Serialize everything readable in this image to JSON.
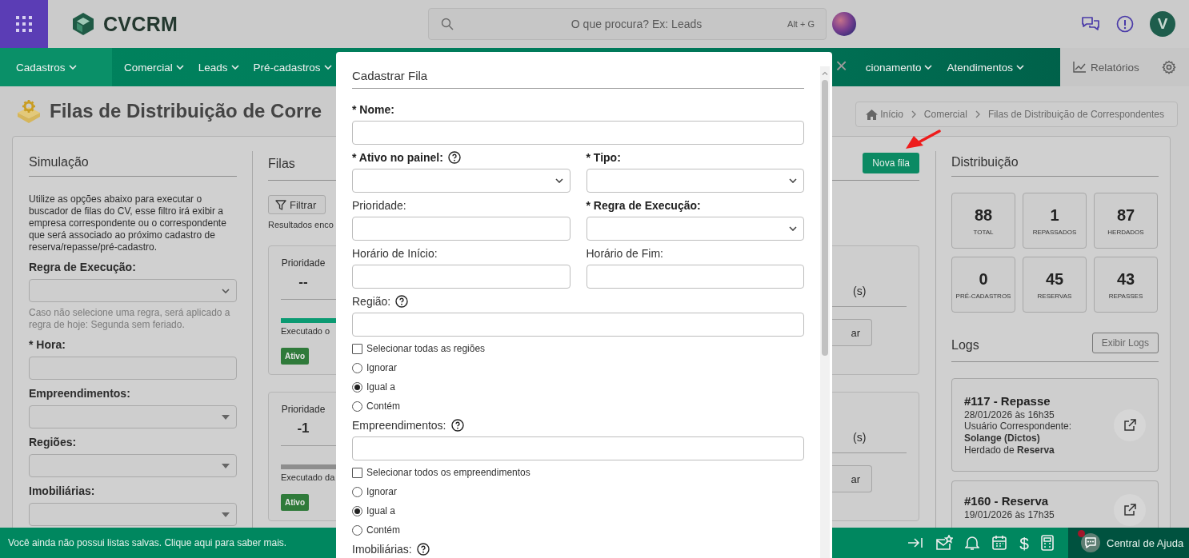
{
  "header": {
    "logo": "**CV**CRM",
    "search": {
      "placeholder": "O que procura? Ex: Leads",
      "shortcut": "Alt + G"
    },
    "avatar": "V"
  },
  "nav": {
    "left_items": [
      {
        "label": "Cadastros",
        "selected": true
      },
      {
        "label": "Comercial",
        "selected": false
      },
      {
        "label": "Leads",
        "selected": false
      },
      {
        "label": "Pré-cadastros",
        "selected": false
      }
    ],
    "right_items": [
      {
        "label": "cionamento",
        "selected": false
      },
      {
        "label": "Atendimentos",
        "selected": false
      }
    ],
    "reports": "Relatórios"
  },
  "page": {
    "title": "Filas de Distribuição de Corre",
    "breadcrumb": [
      "Início",
      "Comercial",
      "Filas de Distribuição de Correspondentes"
    ]
  },
  "simulation": {
    "title": "Simulação",
    "description": "Utilize as opções abaixo para executar o buscador de filas do CV, esse filtro irá exibir a empresa correspondente ou o correspondente que será associado ao próximo cadastro de reserva/repasse/pré-cadastro.",
    "fields": [
      {
        "label": "Regra de Execução:",
        "kind": "select",
        "hint": "Caso não selecione uma regra, será aplicado a regra de hoje: Segunda sem feriado."
      },
      {
        "label": "* Hora:",
        "kind": "input"
      },
      {
        "label": "Empreendimentos:",
        "kind": "dropdown"
      },
      {
        "label": "Regiões:",
        "kind": "dropdown"
      },
      {
        "label": "Imobiliárias:",
        "kind": "dropdown"
      }
    ]
  },
  "queues": {
    "title": "Filas",
    "new_button": "Nova fila",
    "filter_button": "Filtrar",
    "results": "Resultados enco",
    "cards": [
      {
        "priority_label": "Prioridade",
        "priority": "--",
        "color": "#0b9a72",
        "executed": "Executado o",
        "status": "Ativo",
        "side_text": "(s)",
        "side_button": "ar"
      },
      {
        "priority_label": "Prioridade",
        "priority": "-1",
        "color": "#8e8e8e",
        "executed": "Executado da",
        "status": "Ativo",
        "side_text": "(s)",
        "side_button": "ar"
      }
    ]
  },
  "distribution": {
    "title": "Distribuição",
    "stats": [
      {
        "value": "88",
        "label": "TOTAL"
      },
      {
        "value": "1",
        "label": "REPASSADOS"
      },
      {
        "value": "87",
        "label": "HERDADOS"
      },
      {
        "value": "0",
        "label": "PRÉ-CADASTROS"
      },
      {
        "value": "45",
        "label": "RESERVAS"
      },
      {
        "value": "43",
        "label": "REPASSES"
      }
    ]
  },
  "logs": {
    "title": "Logs",
    "button": "Exibir Logs",
    "entries": [
      {
        "title": "#117 - Repasse",
        "date": "28/01/2026 às 16h35",
        "lines": [
          "Usuário Correspondente: **Solange (Dictos)**",
          "Herdado de **Reserva**"
        ]
      },
      {
        "title": "#160 - Reserva",
        "date": "19/01/2026 às 17h35"
      }
    ]
  },
  "modal": {
    "title": "Cadastrar Fila",
    "close": "×",
    "rows": [
      {
        "kind": "input",
        "label": "* Nome:",
        "required": true
      },
      {
        "kind": "pair",
        "fields": [
          {
            "label": "* Ativo no painel:",
            "required": true,
            "help": true,
            "kind": "select"
          },
          {
            "label": "* Tipo:",
            "required": true,
            "kind": "select"
          }
        ]
      },
      {
        "kind": "pair",
        "fields": [
          {
            "label": "Prioridade:",
            "required": false,
            "kind": "input"
          },
          {
            "label": "* Regra de Execução:",
            "required": true,
            "kind": "select"
          }
        ]
      },
      {
        "kind": "pair",
        "fields": [
          {
            "label": "Horário de Início:",
            "required": false,
            "kind": "input"
          },
          {
            "label": "Horário de Fim:",
            "required": false,
            "kind": "input"
          }
        ]
      },
      {
        "kind": "input",
        "label": "Região:",
        "required": false,
        "help": true
      },
      {
        "kind": "checkbox",
        "label": "Selecionar todas as regiões",
        "checked": false
      },
      {
        "kind": "radio",
        "label": "Ignorar",
        "selected": false
      },
      {
        "kind": "radio",
        "label": "Igual a",
        "selected": true
      },
      {
        "kind": "radio",
        "label": "Contém",
        "selected": false
      },
      {
        "kind": "input",
        "label": "Empreendimentos:",
        "required": false,
        "help": true
      },
      {
        "kind": "checkbox",
        "label": "Selecionar todos os empreendimentos",
        "checked": false
      },
      {
        "kind": "radio",
        "label": "Ignorar",
        "selected": false
      },
      {
        "kind": "radio",
        "label": "Igual a",
        "selected": true
      },
      {
        "kind": "radio",
        "label": "Contém",
        "selected": false
      },
      {
        "kind": "label",
        "label": "Imobiliárias:",
        "required": false,
        "help": true
      }
    ]
  },
  "footer": {
    "message": "Você ainda não possui listas salvas. Clique aqui para saber mais.",
    "currency_icon": "$",
    "help": "Central de Ajuda",
    "notification": true
  }
}
